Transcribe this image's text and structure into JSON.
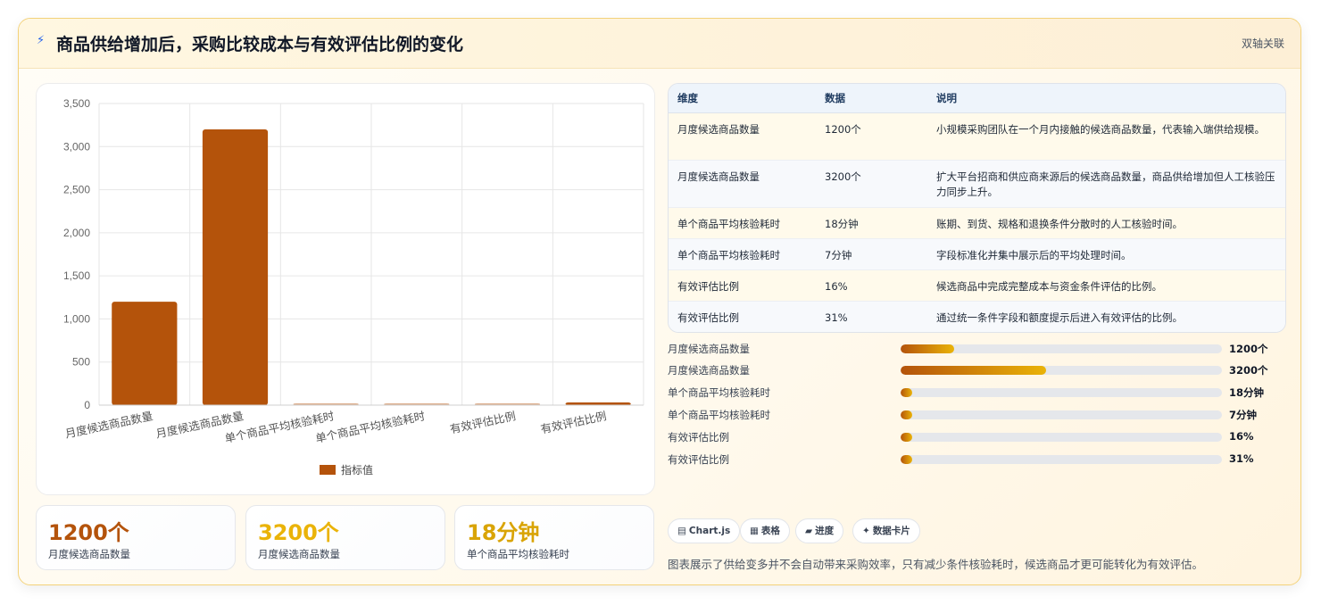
{
  "header": {
    "icon": "lightning-icon",
    "title": "商品供给增加后，采购比较成本与有效评估比例的变化",
    "tag": "双轴关联"
  },
  "colors": {
    "bar": "#b4530b",
    "accent_dark": "#b4530b",
    "accent_gold": "#eab308"
  },
  "chart_data": {
    "type": "bar",
    "categories": [
      "月度候选商品数量",
      "月度候选商品数量",
      "单个商品平均核验耗时",
      "单个商品平均核验耗时",
      "有效评估比例",
      "有效评估比例"
    ],
    "series": [
      {
        "name": "指标值",
        "values": [
          1200,
          3200,
          18,
          7,
          16,
          31
        ]
      }
    ],
    "ylim": [
      0,
      3500
    ],
    "yticks": [
      0,
      500,
      1000,
      1500,
      2000,
      2500,
      3000,
      3500
    ],
    "ytick_labels": [
      "0",
      "500",
      "1,000",
      "1,500",
      "2,000",
      "2,500",
      "3,000",
      "3,500"
    ],
    "grid": true,
    "legend": "bottom"
  },
  "table": {
    "headers": [
      "维度",
      "数据",
      "说明"
    ],
    "rows": [
      {
        "dim": "月度候选商品数量",
        "val": "1200个",
        "desc": "小规模采购团队在一个月内接触的候选商品数量，代表输入端供给规模。"
      },
      {
        "dim": "月度候选商品数量",
        "val": "3200个",
        "desc": "扩大平台招商和供应商来源后的候选商品数量，商品供给增加但人工核验压力同步上升。"
      },
      {
        "dim": "单个商品平均核验耗时",
        "val": "18分钟",
        "desc": "账期、到货、规格和退换条件分散时的人工核验时间。"
      },
      {
        "dim": "单个商品平均核验耗时",
        "val": "7分钟",
        "desc": "字段标准化并集中展示后的平均处理时间。"
      },
      {
        "dim": "有效评估比例",
        "val": "16%",
        "desc": "候选商品中完成完整成本与资金条件评估的比例。"
      },
      {
        "dim": "有效评估比例",
        "val": "31%",
        "desc": "通过统一条件字段和额度提示后进入有效评估的比例。"
      }
    ]
  },
  "progress": [
    {
      "label": "月度候选商品数量",
      "value": "1200个",
      "fraction": 0.167
    },
    {
      "label": "月度候选商品数量",
      "value": "3200个",
      "fraction": 0.453
    },
    {
      "label": "单个商品平均核验耗时",
      "value": "18分钟",
      "fraction": 0.035
    },
    {
      "label": "单个商品平均核验耗时",
      "value": "7分钟",
      "fraction": 0.035
    },
    {
      "label": "有效评估比例",
      "value": "16%",
      "fraction": 0.035
    },
    {
      "label": "有效评估比例",
      "value": "31%",
      "fraction": 0.035
    }
  ],
  "kpis": [
    {
      "value": "1200个",
      "label": "月度候选商品数量",
      "color": "#b4530b"
    },
    {
      "value": "3200个",
      "label": "月度候选商品数量",
      "color": "#eab308"
    },
    {
      "value": "18分钟",
      "label": "单个商品平均核验耗时",
      "color": "#d9a406"
    }
  ],
  "chips": [
    {
      "icon": "chart-icon",
      "glyph": "▤",
      "label": "Chart.js"
    },
    {
      "icon": "table-icon",
      "glyph": "▦",
      "label": "表格"
    },
    {
      "icon": "progress-icon",
      "glyph": "▰",
      "label": "进度"
    },
    {
      "icon": "sparkle-icon",
      "glyph": "✦",
      "label": "数据卡片"
    }
  ],
  "summary": "图表展示了供给变多并不会自动带来采购效率，只有减少条件核验耗时，候选商品才更可能转化为有效评估。"
}
